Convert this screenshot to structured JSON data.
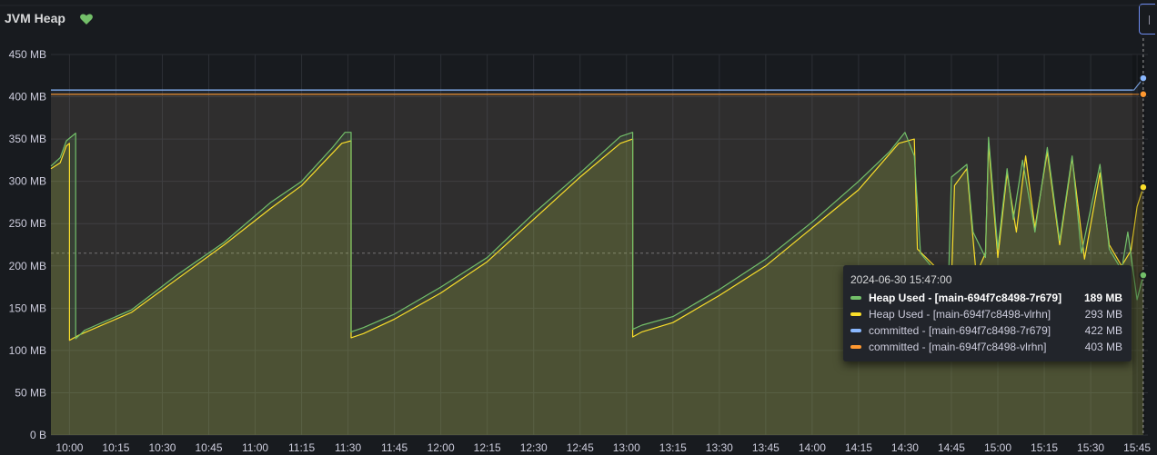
{
  "panel": {
    "title": "JVM Heap",
    "status_icon": "heart-icon",
    "status_color": "#73bf69"
  },
  "chart_data": {
    "type": "line",
    "title": "JVM Heap",
    "xlabel": "",
    "ylabel": "",
    "x_ticks": [
      "10:00",
      "10:15",
      "10:30",
      "10:45",
      "11:00",
      "11:15",
      "11:30",
      "11:45",
      "12:00",
      "12:15",
      "12:30",
      "12:45",
      "13:00",
      "13:15",
      "13:30",
      "13:45",
      "14:00",
      "14:15",
      "14:30",
      "14:45",
      "15:00",
      "15:15",
      "15:30",
      "15:45"
    ],
    "y_ticks": [
      "0 B",
      "50 MB",
      "100 MB",
      "150 MB",
      "200 MB",
      "250 MB",
      "300 MB",
      "350 MB",
      "400 MB",
      "450 MB"
    ],
    "ylim": [
      0,
      450
    ],
    "grid": true,
    "colors": {
      "heap_used_7r679": "#73bf69",
      "heap_used_vlrhn": "#fade2a",
      "committed_7r679": "#8ab8ff",
      "committed_vlrhn": "#ff9830",
      "grid": "#2c2f35"
    },
    "threshold_line": 215,
    "series": [
      {
        "name": "Heap Used - [main-694f7c8498-7r679]",
        "color": "#73bf69",
        "points": [
          [
            "09:54",
            318
          ],
          [
            "09:57",
            328
          ],
          [
            "09:59",
            348
          ],
          [
            "10:02",
            357
          ],
          [
            "10:02",
            114
          ],
          [
            "10:05",
            124
          ],
          [
            "10:20",
            148
          ],
          [
            "10:35",
            190
          ],
          [
            "10:50",
            228
          ],
          [
            "11:05",
            275
          ],
          [
            "11:15",
            300
          ],
          [
            "11:25",
            340
          ],
          [
            "11:29",
            358
          ],
          [
            "11:31",
            358
          ],
          [
            "11:31",
            122
          ],
          [
            "11:35",
            127
          ],
          [
            "11:45",
            143
          ],
          [
            "12:00",
            175
          ],
          [
            "12:15",
            210
          ],
          [
            "12:30",
            262
          ],
          [
            "12:45",
            310
          ],
          [
            "12:58",
            353
          ],
          [
            "13:02",
            358
          ],
          [
            "13:02",
            125
          ],
          [
            "13:05",
            130
          ],
          [
            "13:15",
            140
          ],
          [
            "13:30",
            172
          ],
          [
            "13:45",
            208
          ],
          [
            "14:00",
            252
          ],
          [
            "14:15",
            300
          ],
          [
            "14:25",
            335
          ],
          [
            "14:30",
            358
          ],
          [
            "14:33",
            330
          ],
          [
            "14:35",
            215
          ],
          [
            "14:44",
            175
          ],
          [
            "14:45",
            305
          ],
          [
            "14:50",
            320
          ],
          [
            "14:52",
            240
          ],
          [
            "14:56",
            210
          ],
          [
            "14:57",
            352
          ],
          [
            "15:00",
            220
          ],
          [
            "15:03",
            315
          ],
          [
            "15:05",
            255
          ],
          [
            "15:08",
            325
          ],
          [
            "15:12",
            240
          ],
          [
            "15:16",
            340
          ],
          [
            "15:20",
            230
          ],
          [
            "15:24",
            330
          ],
          [
            "15:27",
            215
          ],
          [
            "15:33",
            320
          ],
          [
            "15:36",
            220
          ],
          [
            "15:40",
            195
          ],
          [
            "15:42",
            240
          ],
          [
            "15:45",
            160
          ],
          [
            "15:47",
            189
          ]
        ]
      },
      {
        "name": "Heap Used - [main-694f7c8498-vlrhn]",
        "color": "#fade2a",
        "points": [
          [
            "09:54",
            315
          ],
          [
            "09:57",
            322
          ],
          [
            "09:59",
            342
          ],
          [
            "10:00",
            345
          ],
          [
            "10:00",
            112
          ],
          [
            "10:03",
            118
          ],
          [
            "10:20",
            145
          ],
          [
            "10:35",
            185
          ],
          [
            "10:50",
            225
          ],
          [
            "11:05",
            268
          ],
          [
            "11:15",
            295
          ],
          [
            "11:28",
            345
          ],
          [
            "11:31",
            348
          ],
          [
            "11:31",
            115
          ],
          [
            "11:35",
            120
          ],
          [
            "11:45",
            137
          ],
          [
            "12:00",
            168
          ],
          [
            "12:15",
            205
          ],
          [
            "12:30",
            255
          ],
          [
            "12:45",
            305
          ],
          [
            "12:58",
            345
          ],
          [
            "13:02",
            350
          ],
          [
            "13:02",
            116
          ],
          [
            "13:05",
            122
          ],
          [
            "13:15",
            133
          ],
          [
            "13:30",
            165
          ],
          [
            "13:45",
            200
          ],
          [
            "14:00",
            245
          ],
          [
            "14:15",
            290
          ],
          [
            "14:28",
            345
          ],
          [
            "14:33",
            350
          ],
          [
            "14:34",
            220
          ],
          [
            "14:45",
            180
          ],
          [
            "14:46",
            295
          ],
          [
            "14:50",
            315
          ],
          [
            "14:53",
            190
          ],
          [
            "14:56",
            215
          ],
          [
            "14:57",
            345
          ],
          [
            "15:00",
            210
          ],
          [
            "15:03",
            310
          ],
          [
            "15:06",
            240
          ],
          [
            "15:09",
            330
          ],
          [
            "15:12",
            245
          ],
          [
            "15:16",
            335
          ],
          [
            "15:20",
            225
          ],
          [
            "15:24",
            328
          ],
          [
            "15:28",
            208
          ],
          [
            "15:33",
            310
          ],
          [
            "15:36",
            225
          ],
          [
            "15:40",
            200
          ],
          [
            "15:43",
            218
          ],
          [
            "15:45",
            270
          ],
          [
            "15:47",
            293
          ]
        ]
      },
      {
        "name": "committed - [main-694f7c8498-7r679]",
        "color": "#8ab8ff",
        "points": [
          [
            "09:54",
            408
          ],
          [
            "15:44",
            408
          ],
          [
            "15:47",
            422
          ]
        ]
      },
      {
        "name": "committed - [main-694f7c8498-vlrhn]",
        "color": "#ff9830",
        "points": [
          [
            "09:54",
            403
          ],
          [
            "15:47",
            403
          ]
        ]
      }
    ],
    "tooltip": {
      "time": "2024-06-30 15:47:00",
      "rows": [
        {
          "label": "Heap Used - [main-694f7c8498-7r679]",
          "value": "189 MB",
          "color": "#73bf69",
          "active": true
        },
        {
          "label": "Heap Used - [main-694f7c8498-vlrhn]",
          "value": "293 MB",
          "color": "#fade2a",
          "active": false
        },
        {
          "label": "committed - [main-694f7c8498-7r679]",
          "value": "422 MB",
          "color": "#8ab8ff",
          "active": false
        },
        {
          "label": "committed - [main-694f7c8498-vlrhn]",
          "value": "403 MB",
          "color": "#ff9830",
          "active": false
        }
      ]
    }
  }
}
